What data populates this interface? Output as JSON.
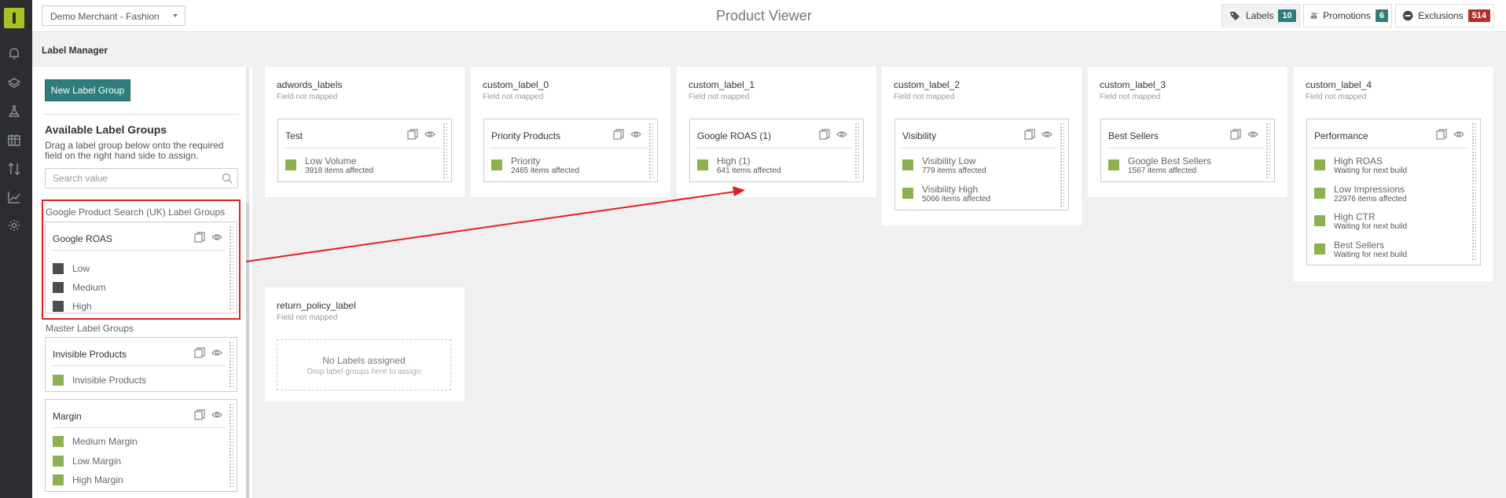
{
  "merchant_selector": {
    "value": "Demo Merchant - Fashion"
  },
  "page_title": "Product Viewer",
  "header_tabs": [
    {
      "label": "Labels",
      "count": "10",
      "badge_color": "#2e7c7c",
      "icon": "tag-icon",
      "active": true
    },
    {
      "label": "Promotions",
      "count": "6",
      "badge_color": "#2e7c7c",
      "icon": "chart-icon",
      "active": false
    },
    {
      "label": "Exclusions",
      "count": "514",
      "badge_color": "#b03030",
      "icon": "minus-circle-icon",
      "active": false
    }
  ],
  "rail_icons": [
    "bell-icon",
    "layers-icon",
    "flask-icon",
    "calendar-icon",
    "sort-icon",
    "trend-icon",
    "gear-icon"
  ],
  "section_title": "Label Manager",
  "left_panel": {
    "new_button": "New Label Group",
    "available_title": "Available Label Groups",
    "available_desc": "Drag a label group below onto the required field on the right hand side to assign.",
    "search_placeholder": "Search value",
    "google_section": "Google Product Search (UK) Label Groups",
    "master_section": "Master Label Groups",
    "groups": [
      {
        "title": "Google ROAS",
        "items": [
          "Low",
          "Medium",
          "High"
        ],
        "color": "dark"
      },
      {
        "title": "Invisible Products",
        "items": [
          "Invisible Products"
        ],
        "color": "green"
      },
      {
        "title": "Margin",
        "items": [
          "Medium Margin",
          "Low Margin",
          "High Margin"
        ],
        "color": "green"
      }
    ]
  },
  "columns": [
    {
      "title": "adwords_labels",
      "sub": "Field not mapped",
      "group": {
        "title": "Test",
        "items": [
          {
            "name": "Low Volume",
            "sub": "3918 items affected"
          }
        ]
      }
    },
    {
      "title": "custom_label_0",
      "sub": "Field not mapped",
      "group": {
        "title": "Priority Products",
        "items": [
          {
            "name": "Priority",
            "sub": "2465 items affected"
          }
        ]
      }
    },
    {
      "title": "custom_label_1",
      "sub": "Field not mapped",
      "group": {
        "title": "Google ROAS (1)",
        "items": [
          {
            "name": "High (1)",
            "sub": "641 items affected"
          }
        ]
      }
    },
    {
      "title": "custom_label_2",
      "sub": "Field not mapped",
      "group": {
        "title": "Visibility",
        "items": [
          {
            "name": "Visibility Low",
            "sub": "779 items affected"
          },
          {
            "name": "Visibility High",
            "sub": "5066 items affected"
          }
        ]
      }
    },
    {
      "title": "custom_label_3",
      "sub": "Field not mapped",
      "group": {
        "title": "Best Sellers",
        "items": [
          {
            "name": "Google Best Sellers",
            "sub": "1567 items affected"
          }
        ]
      }
    },
    {
      "title": "custom_label_4",
      "sub": "Field not mapped",
      "group": {
        "title": "Performance",
        "items": [
          {
            "name": "High ROAS",
            "sub": "Waiting for next build"
          },
          {
            "name": "Low Impressions",
            "sub": "22976 items affected"
          },
          {
            "name": "High CTR",
            "sub": "Waiting for next build"
          },
          {
            "name": "Best Sellers",
            "sub": "Waiting for next build"
          }
        ]
      }
    },
    {
      "title": "return_policy_label",
      "sub": "Field not mapped",
      "empty_title": "No Labels assigned",
      "empty_sub": "Drop label groups here to assign"
    }
  ],
  "colors": {
    "accent": "#2e7c7c",
    "label_green": "#8bb151",
    "label_dark": "#4d4d4d",
    "annotation_red": "#e02020",
    "logo_green": "#a7c227"
  }
}
